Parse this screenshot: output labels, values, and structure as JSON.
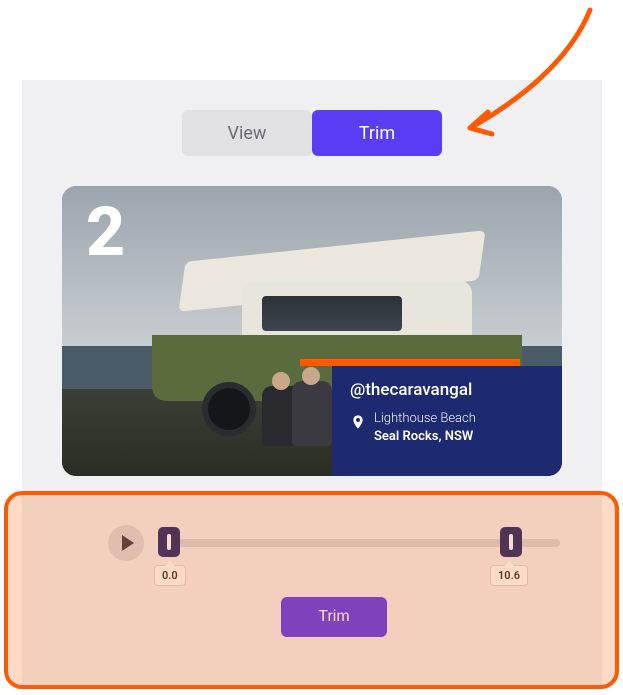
{
  "tabs": {
    "view_label": "View",
    "trim_label": "Trim"
  },
  "clip": {
    "number": "2",
    "handle": "@thecaravangal",
    "location_sub": "Lighthouse Beach",
    "location_main": "Seal Rocks, NSW"
  },
  "trim": {
    "start_time": "0.0",
    "end_time": "10.6",
    "button_label": "Trim"
  },
  "colors": {
    "accent": "#5a3cf2",
    "highlight": "#ff5a00",
    "navy": "#1e2a6f"
  }
}
